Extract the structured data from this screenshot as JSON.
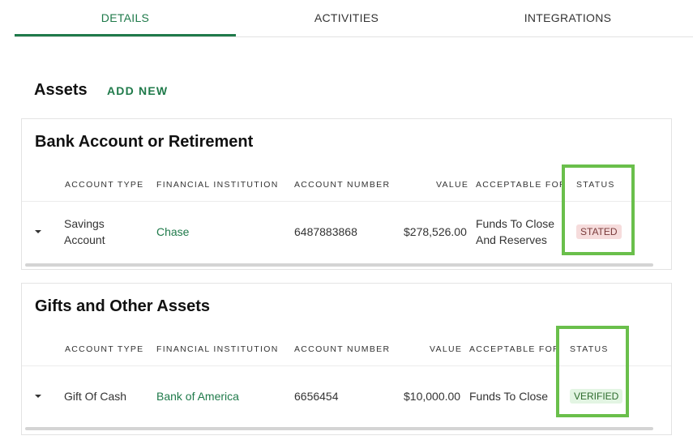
{
  "tabs": [
    {
      "label": "DETAILS",
      "active": true
    },
    {
      "label": "ACTIVITIES",
      "active": false
    },
    {
      "label": "INTEGRATIONS",
      "active": false
    }
  ],
  "assets": {
    "title": "Assets",
    "add_new_label": "ADD NEW"
  },
  "columns": {
    "account_type": "ACCOUNT TYPE",
    "financial_institution": "FINANCIAL INSTITUTION",
    "account_number": "ACCOUNT NUMBER",
    "value": "VALUE",
    "acceptable_for": "ACCEPTABLE FOR",
    "status": "STATUS"
  },
  "sections": [
    {
      "title": "Bank Account or Retirement",
      "rows": [
        {
          "account_type_line1": "Savings",
          "account_type_line2": "Account",
          "financial_institution": "Chase",
          "account_number": "6487883868",
          "value": "$278,526.00",
          "acceptable_for_line1": "Funds To Close",
          "acceptable_for_line2": "And Reserves",
          "status": "STATED"
        }
      ]
    },
    {
      "title": "Gifts and Other Assets",
      "rows": [
        {
          "account_type": "Gift Of Cash",
          "financial_institution": "Bank of America",
          "account_number": "6656454",
          "value": "$10,000.00",
          "acceptable_for": "Funds To Close",
          "status": "VERIFIED"
        }
      ]
    }
  ],
  "colors": {
    "accent": "#1f7a4a",
    "highlight": "#6abf4b",
    "stated_bg": "#f6dcdc",
    "verified_bg": "#e3f5e3"
  }
}
